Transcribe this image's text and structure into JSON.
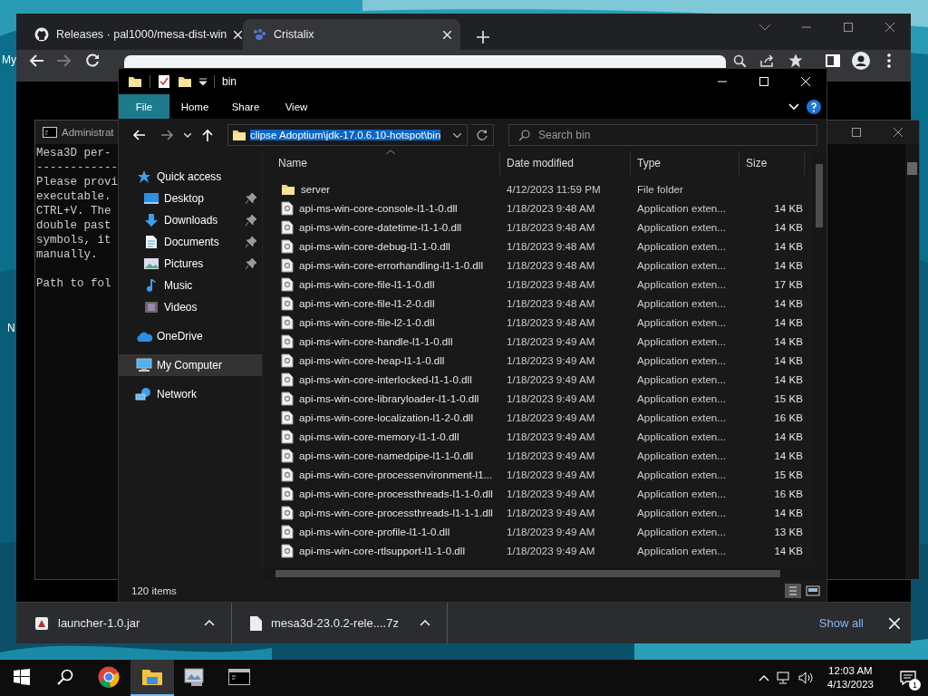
{
  "desktop": {
    "icon_labels": [
      "My",
      "N"
    ]
  },
  "browser": {
    "tabs": [
      {
        "title": "Releases · pal1000/mesa-dist-win",
        "kind": "github",
        "selected": false
      },
      {
        "title": "Cristalix",
        "kind": "paw",
        "selected": true
      }
    ],
    "downloads": [
      {
        "name": "launcher-1.0.jar",
        "kind": "app"
      },
      {
        "name": "mesa3d-23.0.2-rele....7z",
        "kind": "document"
      }
    ],
    "show_all": "Show all"
  },
  "console": {
    "title": "Administrat",
    "paragraphs": [
      [
        "Mesa3D per-",
        "------------",
        "Please provi",
        "executable.",
        "CTRL+V. The",
        "double past",
        "symbols, it",
        "manually."
      ],
      [
        "Path to fol"
      ]
    ]
  },
  "explorer": {
    "title": "bin",
    "ribbon_tabs": [
      {
        "label": "File",
        "selected": true
      },
      {
        "label": "Home",
        "selected": false
      },
      {
        "label": "Share",
        "selected": false
      },
      {
        "label": "View",
        "selected": false
      }
    ],
    "address": "clipse Adoptium\\jdk-17.0.6.10-hotspot\\bin",
    "search": {
      "placeholder": "Search bin"
    },
    "nav": [
      {
        "label": "Quick access",
        "kind": "star",
        "selected": false,
        "pinned": false,
        "children": [
          {
            "label": "Desktop",
            "kind": "desktop",
            "selected": false,
            "pinned": true
          },
          {
            "label": "Downloads",
            "kind": "download",
            "selected": false,
            "pinned": true
          },
          {
            "label": "Documents",
            "kind": "document",
            "selected": false,
            "pinned": true
          },
          {
            "label": "Pictures",
            "kind": "pictures",
            "selected": false,
            "pinned": true
          },
          {
            "label": "Music",
            "kind": "music",
            "selected": false,
            "pinned": false
          },
          {
            "label": "Videos",
            "kind": "videos",
            "selected": false,
            "pinned": false
          }
        ]
      },
      {
        "label": "OneDrive",
        "kind": "cloud",
        "selected": false,
        "pinned": false
      },
      {
        "label": "My Computer",
        "kind": "computer",
        "selected": true,
        "pinned": false
      },
      {
        "label": "Network",
        "kind": "network",
        "selected": false,
        "pinned": false
      }
    ],
    "columns": [
      "Name",
      "Date modified",
      "Type",
      "Size"
    ],
    "rows": [
      {
        "kind": "folder",
        "name": "server",
        "date": "4/12/2023 11:59 PM",
        "type": "File folder"
      },
      {
        "kind": "file",
        "name": "api-ms-win-core-console-l1-1-0.dll",
        "date": "1/18/2023 9:48 AM",
        "type": "Application exten...",
        "size": "14 KB"
      },
      {
        "kind": "file",
        "name": "api-ms-win-core-datetime-l1-1-0.dll",
        "date": "1/18/2023 9:48 AM",
        "type": "Application exten...",
        "size": "14 KB"
      },
      {
        "kind": "file",
        "name": "api-ms-win-core-debug-l1-1-0.dll",
        "date": "1/18/2023 9:48 AM",
        "type": "Application exten...",
        "size": "14 KB"
      },
      {
        "kind": "file",
        "name": "api-ms-win-core-errorhandling-l1-1-0.dll",
        "date": "1/18/2023 9:48 AM",
        "type": "Application exten...",
        "size": "14 KB"
      },
      {
        "kind": "file",
        "name": "api-ms-win-core-file-l1-1-0.dll",
        "date": "1/18/2023 9:48 AM",
        "type": "Application exten...",
        "size": "17 KB"
      },
      {
        "kind": "file",
        "name": "api-ms-win-core-file-l1-2-0.dll",
        "date": "1/18/2023 9:48 AM",
        "type": "Application exten...",
        "size": "14 KB"
      },
      {
        "kind": "file",
        "name": "api-ms-win-core-file-l2-1-0.dll",
        "date": "1/18/2023 9:48 AM",
        "type": "Application exten...",
        "size": "14 KB"
      },
      {
        "kind": "file",
        "name": "api-ms-win-core-handle-l1-1-0.dll",
        "date": "1/18/2023 9:49 AM",
        "type": "Application exten...",
        "size": "14 KB"
      },
      {
        "kind": "file",
        "name": "api-ms-win-core-heap-l1-1-0.dll",
        "date": "1/18/2023 9:49 AM",
        "type": "Application exten...",
        "size": "14 KB"
      },
      {
        "kind": "file",
        "name": "api-ms-win-core-interlocked-l1-1-0.dll",
        "date": "1/18/2023 9:49 AM",
        "type": "Application exten...",
        "size": "14 KB"
      },
      {
        "kind": "file",
        "name": "api-ms-win-core-libraryloader-l1-1-0.dll",
        "date": "1/18/2023 9:49 AM",
        "type": "Application exten...",
        "size": "15 KB"
      },
      {
        "kind": "file",
        "name": "api-ms-win-core-localization-l1-2-0.dll",
        "date": "1/18/2023 9:49 AM",
        "type": "Application exten...",
        "size": "16 KB"
      },
      {
        "kind": "file",
        "name": "api-ms-win-core-memory-l1-1-0.dll",
        "date": "1/18/2023 9:49 AM",
        "type": "Application exten...",
        "size": "14 KB"
      },
      {
        "kind": "file",
        "name": "api-ms-win-core-namedpipe-l1-1-0.dll",
        "date": "1/18/2023 9:49 AM",
        "type": "Application exten...",
        "size": "14 KB"
      },
      {
        "kind": "file",
        "name": "api-ms-win-core-processenvironment-l1...",
        "date": "1/18/2023 9:49 AM",
        "type": "Application exten...",
        "size": "15 KB"
      },
      {
        "kind": "file",
        "name": "api-ms-win-core-processthreads-l1-1-0.dll",
        "date": "1/18/2023 9:49 AM",
        "type": "Application exten...",
        "size": "16 KB"
      },
      {
        "kind": "file",
        "name": "api-ms-win-core-processthreads-l1-1-1.dll",
        "date": "1/18/2023 9:49 AM",
        "type": "Application exten...",
        "size": "14 KB"
      },
      {
        "kind": "file",
        "name": "api-ms-win-core-profile-l1-1-0.dll",
        "date": "1/18/2023 9:49 AM",
        "type": "Application exten...",
        "size": "13 KB"
      },
      {
        "kind": "file",
        "name": "api-ms-win-core-rtlsupport-l1-1-0.dll",
        "date": "1/18/2023 9:49 AM",
        "type": "Application exten...",
        "size": "14 KB"
      }
    ],
    "status": "120 items"
  },
  "taskbar": {
    "apps": [
      {
        "kind": "start",
        "active": false
      },
      {
        "kind": "search",
        "active": false
      },
      {
        "kind": "chrome",
        "active": false
      },
      {
        "kind": "explorer",
        "active": true
      },
      {
        "kind": "monitor",
        "active": false
      },
      {
        "kind": "terminal",
        "active": false
      }
    ],
    "time": "12:03 AM",
    "date": "4/13/2023",
    "notifications": "1"
  }
}
